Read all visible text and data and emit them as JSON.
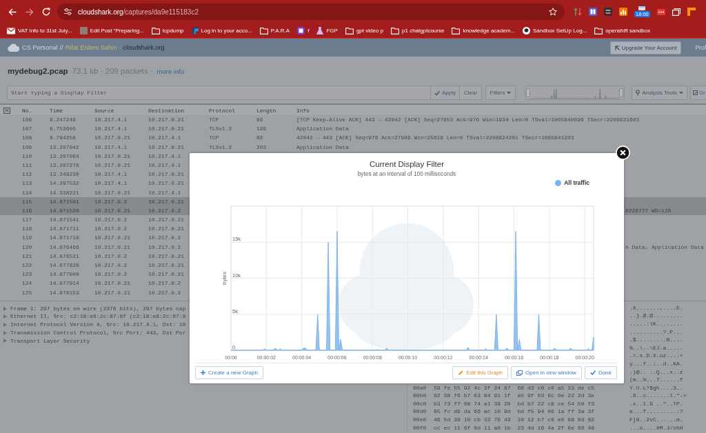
{
  "browser": {
    "url": {
      "host": "cloudshark.org",
      "path": "/captures/da9e115183c2"
    },
    "forward_enabled": false,
    "clock_badge": "18:00"
  },
  "bookmarks": [
    {
      "label": "VAT Info to 31st July...",
      "kind": "mail"
    },
    {
      "label": "Edit Post “Preparing...",
      "kind": "photo"
    },
    {
      "label": "tcpdump",
      "kind": "folder"
    },
    {
      "label": "Log in to your acco...",
      "kind": "site"
    },
    {
      "label": "P.A.R.A",
      "kind": "folder"
    },
    {
      "label": "f",
      "kind": "note"
    },
    {
      "label": "FGP",
      "kind": "flask"
    },
    {
      "label": "gpt video p",
      "kind": "folder"
    },
    {
      "label": "p1 chatgptcourse",
      "kind": "folder"
    },
    {
      "label": "knowledge academ...",
      "kind": "folder"
    },
    {
      "label": "Sandbox SetUp Log...",
      "kind": "cat"
    },
    {
      "label": "openshift sandbox",
      "kind": "folder"
    }
  ],
  "app_header": {
    "account": "CS Personal",
    "separator": "//",
    "user": "Rifat Erdem Sahin",
    "dot": "·",
    "site": "cloudshark.org",
    "upgrade": "Upgrade Your Account",
    "profile": "Prof"
  },
  "capture": {
    "file": "mydebug2.pcap",
    "summary": "73.1 kb · 209 packets ·",
    "more_info": "more info"
  },
  "filter_bar": {
    "placeholder": "Start typing a Display Filter",
    "buttons": [
      {
        "label": "Apply",
        "kind": "apply"
      },
      {
        "label": "Clear",
        "kind": "plain"
      },
      {
        "label": "Filters",
        "kind": "menu"
      }
    ],
    "tools": [
      {
        "label": "Analysis Tools",
        "kind": "analysis"
      },
      {
        "label": "Gr",
        "kind": "graphs"
      }
    ]
  },
  "packet_table": {
    "columns": [
      "No.",
      "Time",
      "Source",
      "Destination",
      "Protocol",
      "Length",
      "Info"
    ],
    "rows": [
      {
        "no": "106",
        "time": "8.247249",
        "source": "10.217.4.1",
        "destination": "10.217.0.21",
        "protocol": "TCP",
        "length": "66",
        "info": "[TCP Keep-Alive ACK] 443 → 42042 [ACK] Seq=27853 Ack=976 Win=1934 Len=0 TSval=1065840696 TSecr=2208621603",
        "selected": false
      },
      {
        "no": "107",
        "time": "8.753605",
        "source": "10.217.4.1",
        "destination": "10.217.0.21",
        "protocol": "TLSv1.2",
        "length": "199",
        "info": "Application Data",
        "selected": false
      },
      {
        "no": "108",
        "time": "8.794258",
        "source": "10.217.0.21",
        "destination": "10.217.4.1",
        "protocol": "TCP",
        "length": "66",
        "info": "42042 → 443 [ACK] Seq=976 Ack=27986 Win=25619 Len=0 TSval=2208624201 TSecr=1065841203",
        "selected": false
      },
      {
        "no": "109",
        "time": "13.207042",
        "source": "10.217.4.1",
        "destination": "10.217.0.21",
        "protocol": "TLSv1.2",
        "length": "203",
        "info": "Application Data",
        "selected": false
      },
      {
        "no": "110",
        "time": "13.207064",
        "source": "10.217.0.21",
        "destination": "10.217.4.1",
        "selected": false
      },
      {
        "no": "111",
        "time": "13.207278",
        "source": "10.217.0.21",
        "destination": "10.217.4.1",
        "selected": false
      },
      {
        "no": "112",
        "time": "13.248230",
        "source": "10.217.4.1",
        "destination": "10.217.0.21",
        "selected": false
      },
      {
        "no": "113",
        "time": "14.297532",
        "source": "10.217.4.1",
        "destination": "10.217.0.21",
        "selected": false
      },
      {
        "no": "114",
        "time": "14.338221",
        "source": "10.217.0.21",
        "destination": "10.217.4.1",
        "selected": false
      },
      {
        "no": "115",
        "time": "14.871501",
        "source": "10.217.0.2",
        "destination": "10.217.0.21",
        "selected": true
      },
      {
        "no": "116",
        "time": "14.871520",
        "source": "10.217.0.21",
        "destination": "10.217.0.2",
        "info_tail": "6226777 WS=128",
        "selected": true
      },
      {
        "no": "117",
        "time": "14.871541",
        "source": "10.217.0.2",
        "destination": "10.217.0.21",
        "selected": false
      },
      {
        "no": "118",
        "time": "14.871711",
        "source": "10.217.0.2",
        "destination": "10.217.0.21",
        "selected": false
      },
      {
        "no": "119",
        "time": "14.871718",
        "source": "10.217.0.21",
        "destination": "10.217.0.2",
        "selected": false
      },
      {
        "no": "120",
        "time": "14.876466",
        "source": "10.217.0.21",
        "destination": "10.217.0.2",
        "info_tail": "n Data, Application Data",
        "selected": false
      },
      {
        "no": "121",
        "time": "14.876521",
        "source": "10.217.0.2",
        "destination": "10.217.0.21",
        "selected": false
      },
      {
        "no": "122",
        "time": "14.877828",
        "source": "10.217.0.2",
        "destination": "10.217.0.21",
        "selected": false
      },
      {
        "no": "123",
        "time": "14.877900",
        "source": "10.217.0.2",
        "destination": "10.217.0.21",
        "selected": false
      },
      {
        "no": "124",
        "time": "14.877914",
        "source": "10.217.0.21",
        "destination": "10.217.0.2",
        "selected": false
      },
      {
        "no": "125",
        "time": "14.878153",
        "source": "10.217.0.21",
        "destination": "10.217.0.2",
        "selected": false
      }
    ]
  },
  "detail_tree": [
    {
      "label": "Frame 1: 297 bytes on wire (2376 bits), 297 bytes cap",
      "expanded": false
    },
    {
      "label": "Ethernet II, Src: c2:18:e8:2c:87:8f (c2:18:e8:2c:87:8",
      "expanded": false
    },
    {
      "label": "Internet Protocol Version 4, Src: 10.217.4.1, Dst: 10",
      "expanded": false
    },
    {
      "label": "Transmission Control Protocol, Src Port: 443, Dst Por",
      "expanded": false
    },
    {
      "label": "Transport Layer Security",
      "expanded": false
    }
  ],
  "hex_dump": [
    {
      "ascii": ".X.......,....E."
    },
    {
      "ascii": "..}.@.@........."
    },
    {
      "ascii": ".....:lK........"
    },
    {
      "ascii": "..........?.P..."
    },
    {
      "ascii": ".$.........B...."
    },
    {
      "ascii": "%..\\..\\EJ.a....."
    },
    {
      "ascii": ".=.s.D.X.uz....+"
    },
    {
      "ascii": "y...f..;..d..KA."
    },
    {
      "ascii": ".)@.. ..Q...x..z"
    },
    {
      "ascii": "(m..%...7......f"
    },
    {
      "offset": "00a0",
      "hex": "59 fe 55 92 4c 3f 24 67  68 d3 c0 c0 a5 33 de c5",
      "ascii": "Y.U.L?$gh....3.."
    },
    {
      "offset": "00b0",
      "hex": "92 38 f6 b7 63 84 91 1f  a5 9f 03 6c 0e 22 2d 3e",
      "ascii": ".8..c.......l.\"->"
    },
    {
      "offset": "00c0",
      "hex": "b3 73 f7 08 74 a1 39 20  bd b7 22 c8 ce 54 50 f3",
      "ascii": ".s..t.9 ..\"..TP."
    },
    {
      "offset": "00d0",
      "hex": "65 fc d9 da 66 ac 10 9d  bd f5 94 06 1a ff 3a 3f",
      "ascii": "e...f.........:?"
    },
    {
      "offset": "00e0",
      "hex": "46 5d 38 10 cb 32 76 43  10 12 b7 c6 e0 88 6d 82",
      "ascii": "F]8..2vC......m."
    },
    {
      "offset": "00f0",
      "hex": "cc ec 11 6f 0d 11 a0 1b  23 4d 16 4a 2f 6e 68 48",
      "ascii": "...o....#M.J/nhH"
    }
  ],
  "modal": {
    "subtitle": "bytes at an interval of 100 milliseconds",
    "chart_data": {
      "type": "area",
      "title": "Current Display Filter",
      "ylabel": "bytes",
      "grid": true,
      "x": [
        0,
        1.8,
        1.9,
        2.0,
        2.4,
        2.5,
        2.6,
        2.7,
        2.8,
        2.9,
        4.0,
        4.1,
        4.2,
        4.3,
        4.8,
        4.9,
        5.0,
        5.4,
        5.5,
        5.6,
        5.9,
        6.0,
        6.1,
        6.2,
        6.3,
        8.2,
        8.3,
        8.4,
        8.7,
        8.8,
        8.9,
        13.3,
        13.4,
        13.5,
        14.3,
        14.4,
        14.5,
        14.9,
        15.0,
        15.1,
        15.5,
        15.6,
        15.7,
        16.0,
        16.1,
        16.2,
        16.3,
        16.4,
        17.3,
        17.4,
        17.5,
        18.2,
        18.3,
        18.4,
        19.1,
        19.2,
        19.3,
        20.1,
        20.2,
        20.3,
        20.4,
        20.5
      ],
      "series": [
        {
          "name": "All traffic",
          "color": "#7cb5ec",
          "values": [
            0,
            0,
            200,
            0,
            0,
            300,
            0,
            0,
            200,
            0,
            0,
            300,
            300,
            0,
            0,
            5000,
            0,
            0,
            15000,
            0,
            0,
            16500,
            0,
            1500,
            0,
            0,
            100,
            0,
            0,
            300,
            0,
            0,
            400,
            0,
            0,
            200,
            0,
            0,
            5000,
            0,
            0,
            300,
            0,
            0,
            16500,
            0,
            1500,
            0,
            0,
            5000,
            0,
            0,
            300,
            0,
            0,
            300,
            0,
            0,
            200,
            0,
            0,
            1800
          ]
        }
      ],
      "xlim": [
        0,
        20.5
      ],
      "ylim": [
        0,
        20000
      ],
      "xticks": [
        {
          "value": 0,
          "label": "00:00"
        },
        {
          "value": 2,
          "label": "00:00:02"
        },
        {
          "value": 4,
          "label": "00:00:04"
        },
        {
          "value": 6,
          "label": "00:00:06"
        },
        {
          "value": 8,
          "label": "00:00:08"
        },
        {
          "value": 10,
          "label": "00:00:10"
        },
        {
          "value": 12,
          "label": "00:00:12"
        },
        {
          "value": 14,
          "label": "00:00:14"
        },
        {
          "value": 16,
          "label": "00:00:16"
        },
        {
          "value": 18,
          "label": "00:00:18"
        },
        {
          "value": 20,
          "label": "00:00:20"
        }
      ],
      "yticks": [
        {
          "value": 0,
          "label": "0"
        },
        {
          "value": 5000,
          "label": "5k"
        },
        {
          "value": 10000,
          "label": "10k"
        },
        {
          "value": 15000,
          "label": "15k"
        }
      ]
    },
    "buttons": [
      {
        "label": "Create a new Graph",
        "kind": "create"
      },
      {
        "label": "Edit this Graph",
        "kind": "edit"
      },
      {
        "label": "Open in new window",
        "kind": "open"
      },
      {
        "label": "Done",
        "kind": "done"
      }
    ]
  }
}
